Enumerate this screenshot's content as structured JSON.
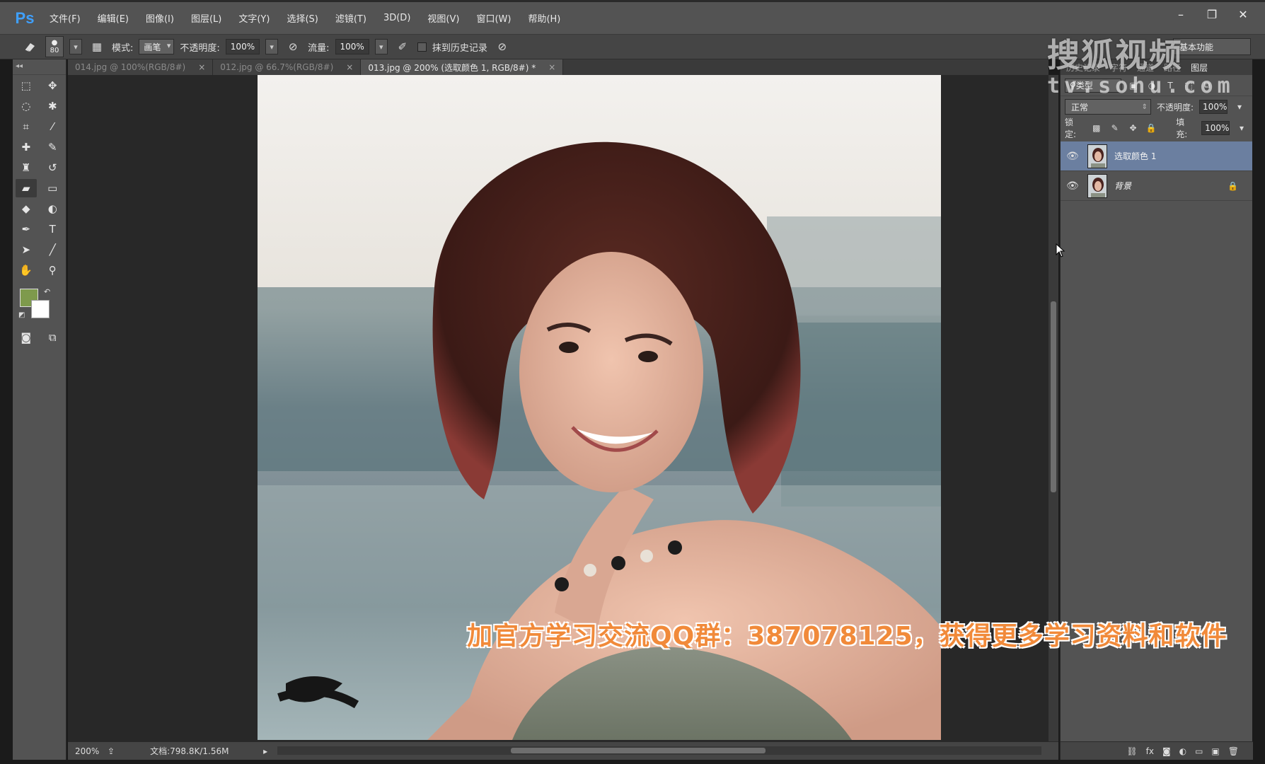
{
  "app": {
    "logo": "Ps"
  },
  "menu": [
    "文件(F)",
    "编辑(E)",
    "图像(I)",
    "图层(L)",
    "文字(Y)",
    "选择(S)",
    "滤镜(T)",
    "3D(D)",
    "视图(V)",
    "窗口(W)",
    "帮助(H)"
  ],
  "window_controls": {
    "minimize": "–",
    "restore": "❐",
    "close": "✕"
  },
  "options": {
    "brush_size": "80",
    "mode_label": "模式:",
    "mode_value": "画笔",
    "opacity_label": "不透明度:",
    "opacity_value": "100%",
    "flow_label": "流量:",
    "flow_value": "100%",
    "erase_history_label": "抹到历史记录",
    "workspace": "基本功能"
  },
  "tabs": [
    {
      "label": "014.jpg @ 100%(RGB/8#)",
      "close": "×"
    },
    {
      "label": "012.jpg @ 66.7%(RGB/8#)",
      "close": "×"
    },
    {
      "label": "013.jpg @ 200% (选取颜色 1, RGB/8#) *",
      "close": "×"
    }
  ],
  "colors": {
    "foreground": "#7e9a4c",
    "background": "#ffffff",
    "selected_layer": "#6b7fa0"
  },
  "status": {
    "zoom": "200%",
    "doc": "文档:798.8K/1.56M"
  },
  "panels": {
    "tabs": [
      "历史记录",
      "字符",
      "通道",
      "路径",
      "图层"
    ],
    "kind": "类型",
    "blend_mode": "正常",
    "opacity_label": "不透明度:",
    "opacity_value": "100%",
    "lock_label": "锁定:",
    "fill_label": "填充:",
    "fill_value": "100%",
    "layers": [
      {
        "name": "选取颜色 1",
        "selected": true
      },
      {
        "name": "背景",
        "locked": true
      }
    ]
  },
  "watermark": {
    "logo": "搜狐视频",
    "domain": "tv.sohu.com"
  },
  "caption": "加官方学习交流QQ群：387078125，获得更多学习资料和软件"
}
